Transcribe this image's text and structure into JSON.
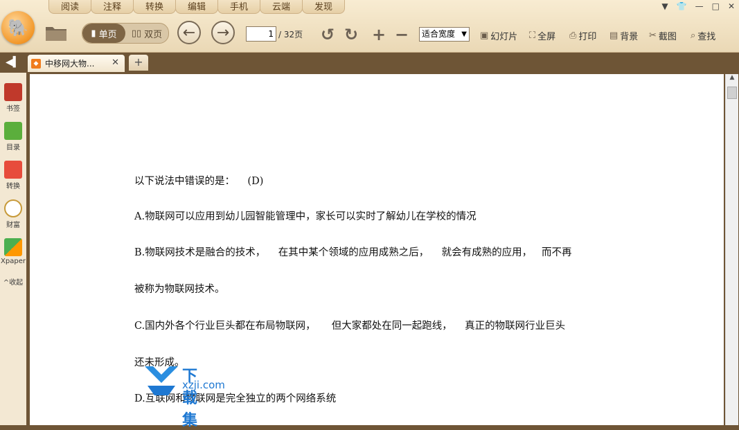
{
  "menu": [
    "阅读",
    "注释",
    "转换",
    "编辑",
    "手机",
    "云端",
    "发现"
  ],
  "window_controls": [
    "▼",
    "👕",
    "—",
    "□",
    "✕"
  ],
  "view_mode": {
    "single": "单页",
    "double": "双页"
  },
  "page_nav": {
    "current": "1",
    "total": "/ 32页"
  },
  "zoom": {
    "selected": "适合宽度"
  },
  "tools": [
    "幻灯片",
    "全屏",
    "打印",
    "背景",
    "截图",
    "查找"
  ],
  "tab": {
    "title": "中移网大物...",
    "close": "✕",
    "new": "+"
  },
  "sidebar": [
    "书签",
    "目录",
    "转换",
    "财富",
    "Xpaper",
    "收起"
  ],
  "document": {
    "lines": [
      "以下说法中错误的是：    (D)",
      "A.物联网可以应用到幼儿园智能管理中，家长可以实时了解幼儿在学校的情况",
      "B.物联网技术是融合的技术，    在其中某个领域的应用成熟之后，    就会有成熟的应用，   而不再",
      "被称为物联网技术。",
      "C.国内外各个行业巨头都在布局物联网，     但大家都处在同一起跑线，    真正的物联网行业巨头",
      "还未形成。",
      "D.互联网和物联网是完全独立的两个网络系统"
    ]
  },
  "watermark": {
    "title": "下载集",
    "url": "xzji.com"
  }
}
